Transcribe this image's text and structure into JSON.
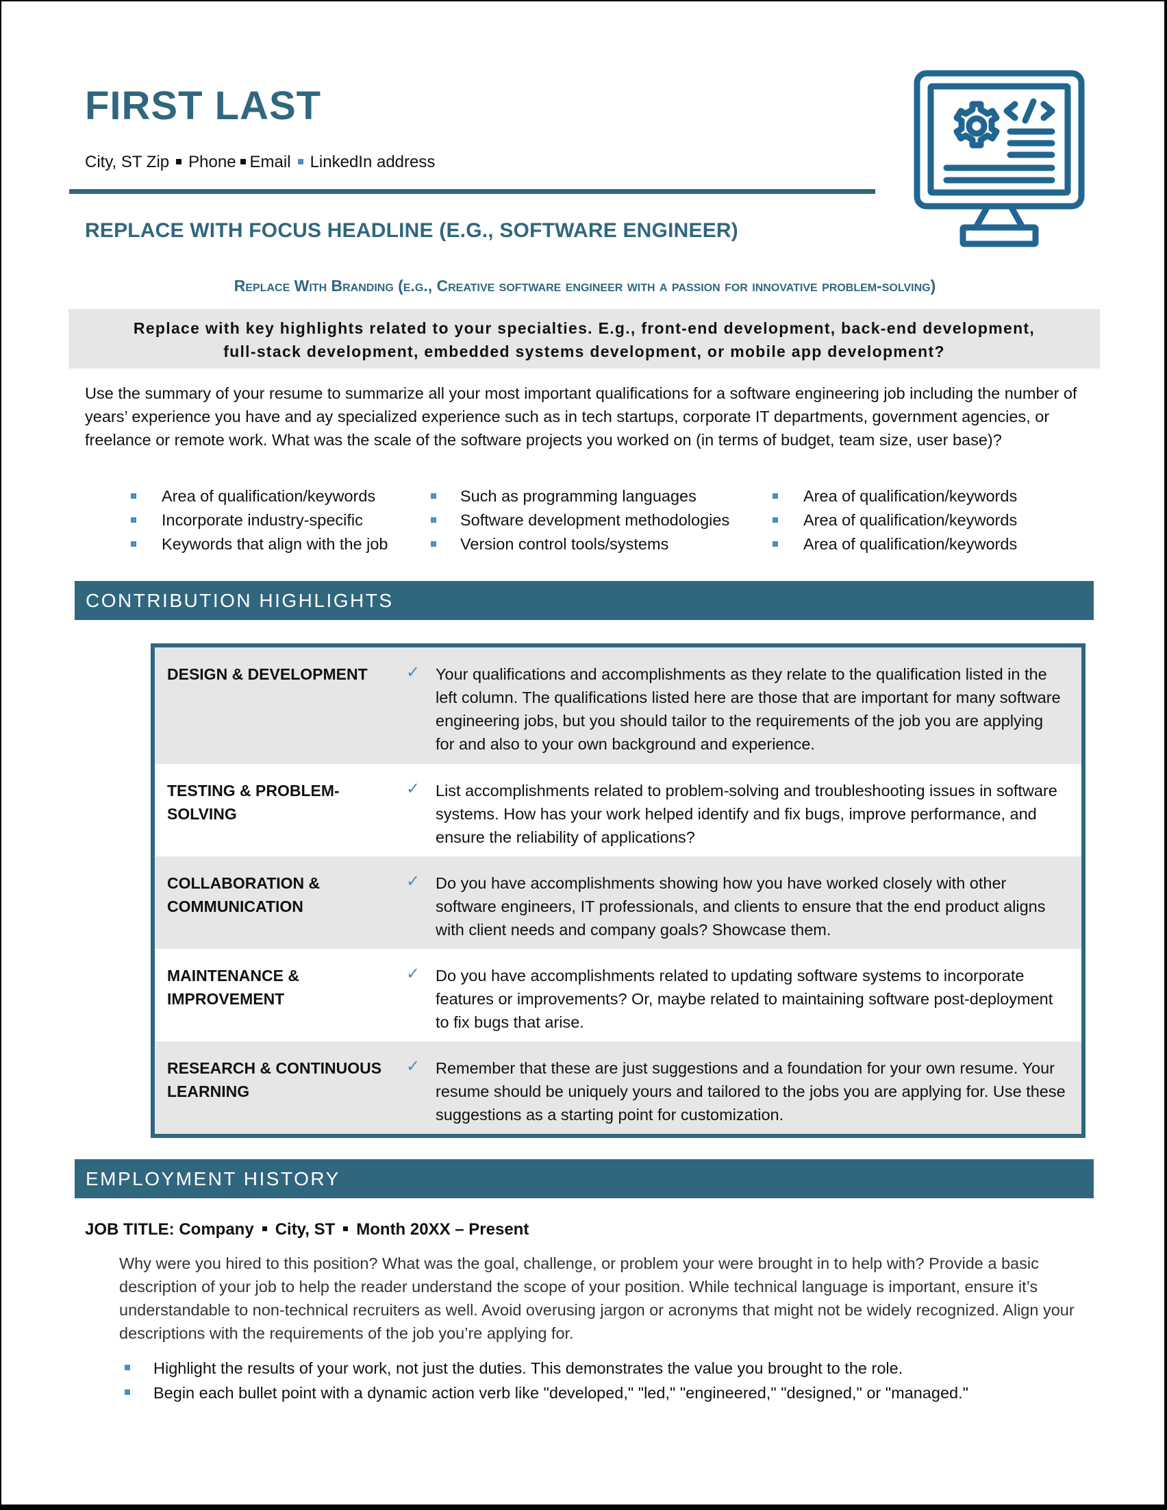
{
  "header": {
    "name": "FIRST LAST",
    "contact": {
      "city": "City, ST Zip",
      "phone": "Phone",
      "email": "Email",
      "linkedin": "LinkedIn address"
    },
    "focus_headline": "REPLACE WITH FOCUS HEADLINE (E.G., SOFTWARE ENGINEER)",
    "branding": "Replace With Branding (e.g., Creative software engineer with a passion for innovative problem-solving)",
    "icon": "computer-monitor-code-gear-icon"
  },
  "key_highlights": {
    "line1": "Replace with key highlights related to your specialties. E.g., front-end development, back-end development,",
    "line2": "full-stack development, embedded systems development, or mobile app development?"
  },
  "summary": "Use the summary of your resume to summarize all your most important qualifications for a software engineering job including the number of years’ experience you have and ay specialized experience such as in tech startups, corporate IT departments, government agencies, or freelance or remote work. What was the scale of the software projects you worked on (in terms of budget, team size, user base)?",
  "keywords": {
    "col1": [
      "Area of qualification/keywords",
      "Incorporate industry-specific",
      "Keywords that align with the job"
    ],
    "col2": [
      "Such as programming languages",
      "Software development methodologies",
      "Version control tools/systems"
    ],
    "col3": [
      "Area of qualification/keywords",
      "Area of qualification/keywords",
      "Area of qualification/keywords"
    ]
  },
  "contribution": {
    "title": "CONTRIBUTION HIGHLIGHTS",
    "rows": [
      {
        "label": "DESIGN & DEVELOPMENT",
        "check": "✓",
        "text": "Your qualifications and accomplishments as they relate to the qualification listed in the left column. The qualifications listed here are those that are important for many software engineering jobs, but you should tailor to the requirements of the job you are applying for and also to your own background and experience."
      },
      {
        "label": "TESTING & PROBLEM-SOLVING",
        "check": "✓",
        "text": "List accomplishments related to problem-solving and troubleshooting issues in software systems. How has your work helped identify and fix bugs, improve performance, and ensure the reliability of applications?"
      },
      {
        "label": "COLLABORATION & COMMUNICATION",
        "check": "✓",
        "text": "Do you have accomplishments showing how you have worked closely with other software engineers, IT professionals, and clients to ensure that the end product aligns with client needs and company goals? Showcase them."
      },
      {
        "label": "MAINTENANCE & IMPROVEMENT",
        "check": "✓",
        "text": "Do you have accomplishments related to updating software systems to incorporate features or improvements? Or, maybe related to maintaining software post-deployment to fix bugs that arise."
      },
      {
        "label": "RESEARCH & CONTINUOUS LEARNING",
        "check": "✓",
        "text": "Remember that these are just suggestions and a foundation for your own resume. Your resume should be uniquely yours and tailored to the jobs you are applying for. Use these suggestions as a starting point for customization."
      }
    ]
  },
  "employment": {
    "title": "EMPLOYMENT HISTORY",
    "job": {
      "title_company": "JOB TITLE: Company",
      "location": "City, ST",
      "dates": "Month 20XX – Present",
      "description": "Why were you hired to this position? What was the goal, challenge, or problem your were brought in to help with? Provide a basic description of your job to help the reader understand the scope of your position.  While technical language is important, ensure it’s understandable to non-technical recruiters as well. Avoid overusing jargon or acronyms that might not be widely recognized. Align your descriptions with the requirements of the job you’re applying for.",
      "bullets": [
        "Highlight the results of your work, not just the duties. This demonstrates the value you brought to the role.",
        "Begin each bullet point with a dynamic action verb like \"developed,\" \"led,\" \"engineered,\" \"designed,\" or \"managed.\""
      ]
    }
  },
  "colors": {
    "accent": "#30677f",
    "bullet": "#4a8fbd",
    "shade": "#e6e6e6"
  }
}
